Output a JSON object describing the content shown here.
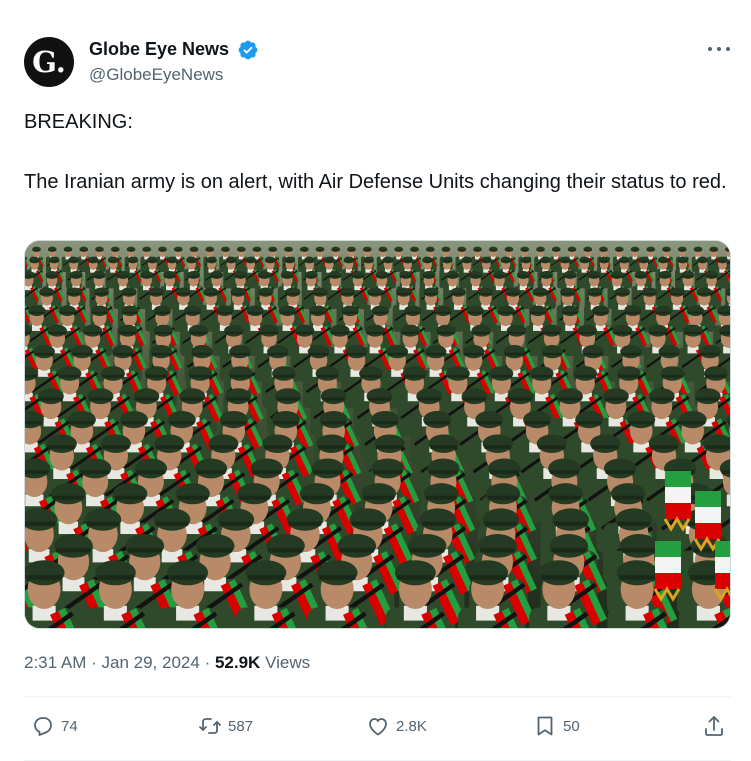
{
  "author": {
    "avatar_letter": "G.",
    "name": "Globe Eye News",
    "handle": "@GlobeEyeNews",
    "verified_color": "#1d9bf0"
  },
  "tweet": {
    "paragraphs": [
      "BREAKING:",
      "The Iranian army is on alert, with Air Defense Units changing their status to red."
    ]
  },
  "media": {
    "icon": "photo"
  },
  "meta": {
    "time": "2:31 AM",
    "separator": "·",
    "date": "Jan 29, 2024",
    "views_count": "52.9K",
    "views_label": "Views"
  },
  "actions": {
    "replies": "74",
    "reposts": "587",
    "likes": "2.8K",
    "bookmarks": "50",
    "share_icon": "share-icon"
  },
  "colors": {
    "text_primary": "#0f1419",
    "text_secondary": "#536471",
    "uniform_green": "#2f4a2a",
    "flag_green": "#239f40",
    "flag_red": "#da0000"
  }
}
